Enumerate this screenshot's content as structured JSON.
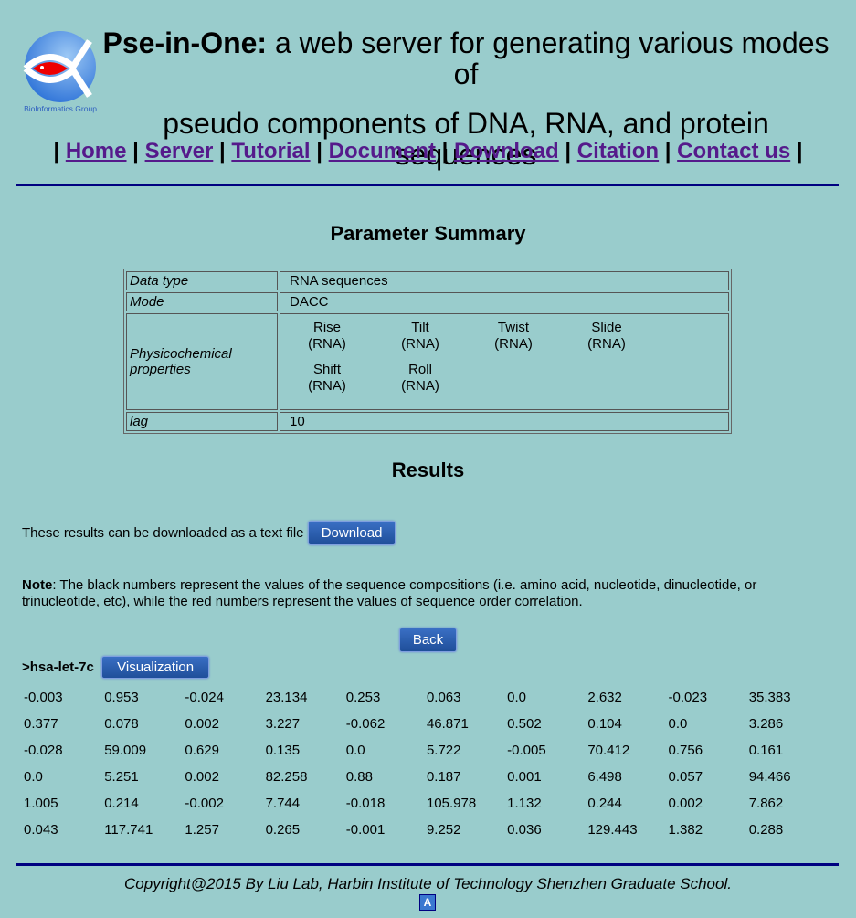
{
  "header": {
    "logo_text": "BioInformatics Group",
    "title_bold": "Pse-in-One:",
    "title_rest": " a web server for generating various modes of",
    "title_line2": "pseudo components of DNA, RNA, and protein sequences"
  },
  "nav": [
    "Home",
    "Server",
    "Tutorial",
    "Document",
    "Download",
    "Citation",
    "Contact us"
  ],
  "summary": {
    "heading": "Parameter Summary",
    "rows": {
      "data_type_label": "Data type",
      "data_type": "RNA sequences",
      "mode_label": "Mode",
      "mode": "DACC",
      "props_label": "Physicochemical properties",
      "lag_label": "lag",
      "lag": "10"
    },
    "props": [
      [
        "Rise",
        "(RNA)"
      ],
      [
        "Tilt",
        "(RNA)"
      ],
      [
        "Twist",
        "(RNA)"
      ],
      [
        "Slide",
        "(RNA)"
      ],
      [
        "Shift",
        "(RNA)"
      ],
      [
        "Roll",
        "(RNA)"
      ]
    ]
  },
  "results": {
    "heading": "Results",
    "download_text": "These results can be downloaded as a text file",
    "download_button": "Download",
    "note_label": "Note",
    "note_text": ": The black numbers represent the values of the sequence compositions (i.e. amino acid, nucleotide, dinucleotide, or trinucleotide, etc), while the red numbers represent the values of sequence order correlation.",
    "back_button": "Back",
    "sequence_name": ">hsa-let-7c",
    "visualization_button": "Visualization",
    "values": [
      "-0.003",
      "0.953",
      "-0.024",
      "23.134",
      "0.253",
      "0.063",
      "0.0",
      "2.632",
      "-0.023",
      "35.383",
      "0.377",
      "0.078",
      "0.002",
      "3.227",
      "-0.062",
      "46.871",
      "0.502",
      "0.104",
      "0.0",
      "3.286",
      "-0.028",
      "59.009",
      "0.629",
      "0.135",
      "0.0",
      "5.722",
      "-0.005",
      "70.412",
      "0.756",
      "0.161",
      "0.0",
      "5.251",
      "0.002",
      "82.258",
      "0.88",
      "0.187",
      "0.001",
      "6.498",
      "0.057",
      "94.466",
      "1.005",
      "0.214",
      "-0.002",
      "7.744",
      "-0.018",
      "105.978",
      "1.132",
      "0.244",
      "0.002",
      "7.862",
      "0.043",
      "117.741",
      "1.257",
      "0.265",
      "-0.001",
      "9.252",
      "0.036",
      "129.443",
      "1.382",
      "0.288"
    ]
  },
  "footer": {
    "copyright": "Copyright@2015 By Liu Lab, Harbin Institute of Technology Shenzhen Graduate School.",
    "icon_letter": "A"
  },
  "colors": {
    "background": "#99cccc",
    "link": "#551a8b",
    "rule": "#000080",
    "button": "#2a5fb0"
  }
}
